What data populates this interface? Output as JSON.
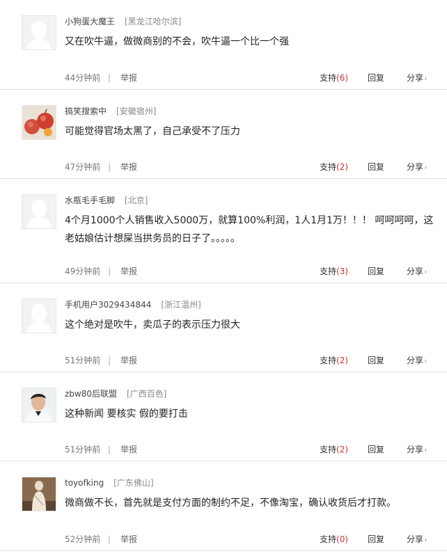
{
  "comments": [
    {
      "user": "小狗蛋大魔王",
      "location": "[黑龙江哈尔滨]",
      "text": "又在吹牛逼，做微商别的不会，吹牛逼一个比一个强",
      "time": "44分钟前",
      "report": "举报",
      "support_label": "支持",
      "support_count": "(6)",
      "reply": "回复",
      "share": "分享",
      "avatar": "default-avatar-icon"
    },
    {
      "user": "搞笑搜索中",
      "location": "[安徽宿州]",
      "text": "可能觉得官场太黑了，自己承受不了压力",
      "time": "47分钟前",
      "report": "举报",
      "support_label": "支持",
      "support_count": "(2)",
      "reply": "回复",
      "share": "分享",
      "avatar": "apples-photo"
    },
    {
      "user": "水瓶毛手毛脚",
      "location": "[北京]",
      "text": "4个月1000个人销售收入5000万，就算100%利润，1人1月1万！！！ 呵呵呵呵，这老姑娘估计想屎当拱务员的日子了。。。。。",
      "time": "49分钟前",
      "report": "举报",
      "support_label": "支持",
      "support_count": "(3)",
      "reply": "回复",
      "share": "分享",
      "avatar": "default-avatar-icon"
    },
    {
      "user": "手机用户3029434844",
      "location": "[浙江温州]",
      "text": "这个绝对是吹牛，卖瓜子的表示压力很大",
      "time": "51分钟前",
      "report": "举报",
      "support_label": "支持",
      "support_count": "(2)",
      "reply": "回复",
      "share": "分享",
      "avatar": "default-avatar-icon"
    },
    {
      "user": "zbw80后联盟",
      "location": "[广西百色]",
      "text": "这种新闻 要核实 假的要打击",
      "time": "51分钟前",
      "report": "举报",
      "support_label": "支持",
      "support_count": "(2)",
      "reply": "回复",
      "share": "分享",
      "avatar": "man-photo"
    },
    {
      "user": "toyofking",
      "location": "[广东佛山]",
      "text": "微商做不长，首先就是支付方面的制约不足，不像淘宝，确认收货后才打款。",
      "time": "52分钟前",
      "report": "举报",
      "support_label": "支持",
      "support_count": "(0)",
      "reply": "回复",
      "share": "分享",
      "avatar": "statue-photo"
    }
  ],
  "share_arrow": "›",
  "separator": "|"
}
